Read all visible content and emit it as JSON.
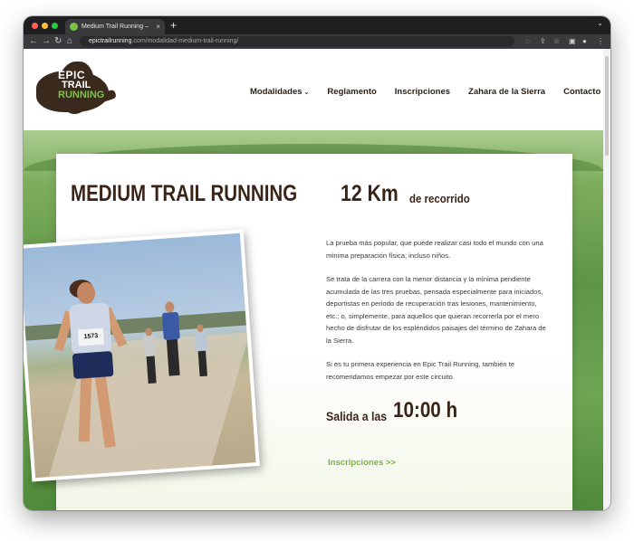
{
  "browser": {
    "tab_title": "Medium Trail Running – Epic Tr",
    "tab_close": "×",
    "new_tab": "+",
    "address_host": "epictrailrunning",
    "address_path": ".com/modalidad-medium-trail-running/",
    "icons": [
      "back-icon",
      "forward-icon",
      "reload-icon",
      "home-icon",
      "eye-off-icon",
      "share-icon",
      "star-icon",
      "sidebar-icon",
      "profile-icon",
      "menu-icon"
    ]
  },
  "site": {
    "logo": {
      "line1": "EPIC",
      "line2": "TRAIL",
      "line3": "RUNNING"
    },
    "nav": [
      {
        "label": "Modalidades",
        "has_dropdown": true
      },
      {
        "label": "Reglamento"
      },
      {
        "label": "Inscripciones"
      },
      {
        "label": "Zahara de la Sierra"
      },
      {
        "label": "Contacto"
      }
    ]
  },
  "content": {
    "title": "MEDIUM TRAIL RUNNING",
    "distance": "12 Km",
    "distance_suffix": "de recorrido",
    "bib_number": "1573",
    "paragraphs": [
      "La prueba más popular, que puede realizar casi todo el mundo con una mínima preparación física; incluso niños.",
      "Se trata de la carrera con la menor distancia y la mínima pendiente acumulada de las tres pruebas, pensada especialmente para iniciados, deportistas en periodo de recuperación tras lesiones, mantenimiento, etc.; o, simplemente, para aquellos que quieran recorrerla por el mero hecho de disfrutar de los espléndidos paisajes del término de Zahara de la Sierra.",
      "Si es tu primera experiencia en Epic Trail Running, también te recomendamos empezar por este circuito."
    ],
    "start_label": "Salida a las",
    "start_time": "10:00 h",
    "cta_label": "Inscripciones >>"
  },
  "colors": {
    "brand_dark": "#3a2418",
    "brand_green": "#7cb342",
    "grass": "#5e9546"
  }
}
